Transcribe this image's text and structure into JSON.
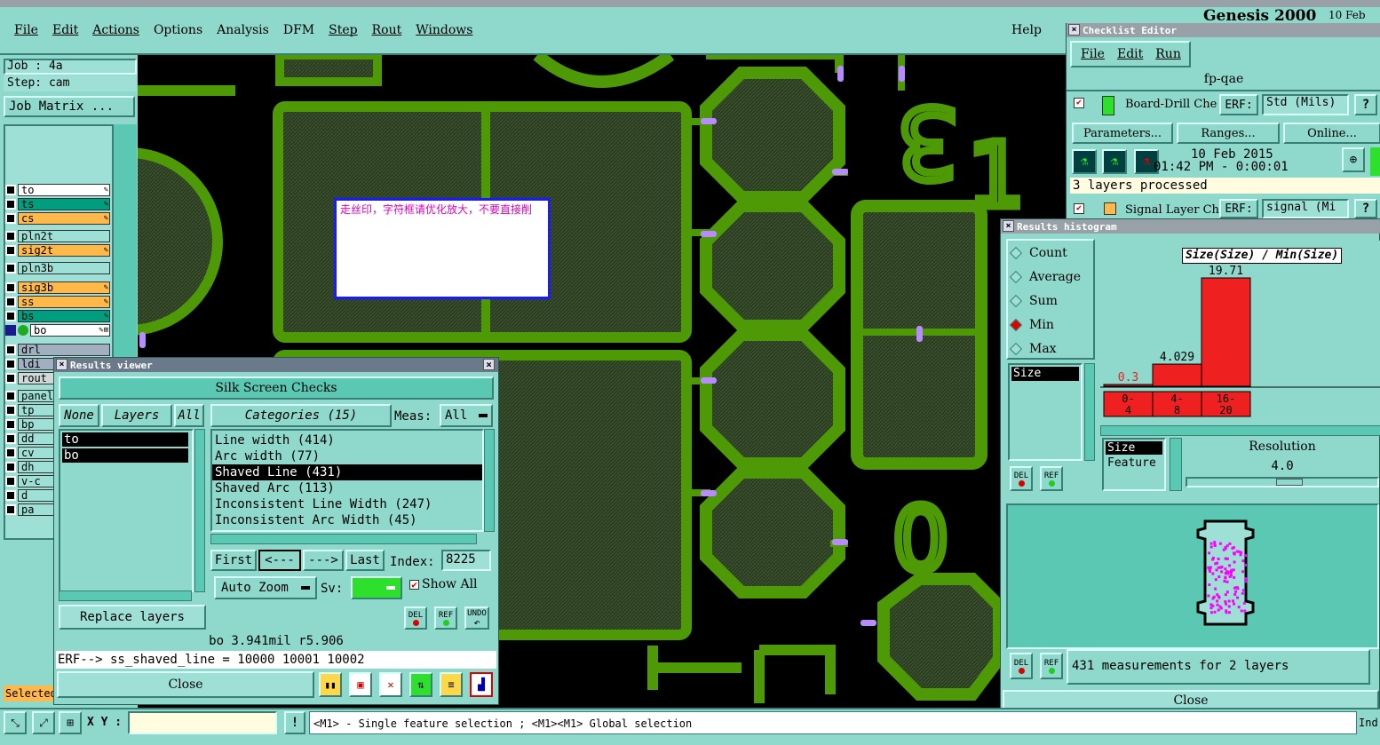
{
  "menu": {
    "items": [
      "File",
      "Edit",
      "Actions",
      "Options",
      "Analysis",
      "DFM",
      "Step",
      "Rout",
      "Windows"
    ],
    "help": "Help"
  },
  "job": {
    "job": "Job : 4a",
    "step": "Step: cam",
    "matrix": "Job Matrix ..."
  },
  "layers": [
    {
      "name": "to",
      "color": "#ffffff",
      "mark": "✎"
    },
    {
      "name": "ts",
      "color": "#009e7e",
      "mark": "✎"
    },
    {
      "name": "cs",
      "color": "#ffb84a",
      "mark": "✎"
    },
    {
      "name": "pln2t",
      "color": "#9ee0d6",
      "mark": ""
    },
    {
      "name": "sig2t",
      "color": "#ffb84a",
      "mark": "✎"
    },
    {
      "name": "pln3b",
      "color": "#9ee0d6",
      "mark": ""
    },
    {
      "name": "sig3b",
      "color": "#ffb84a",
      "mark": "✎"
    },
    {
      "name": "ss",
      "color": "#ffb84a",
      "mark": "✎"
    },
    {
      "name": "bs",
      "color": "#009e7e",
      "mark": "✎"
    },
    {
      "name": "bo",
      "color": "#ffffff",
      "mark": "✎⊞"
    },
    {
      "name": "drl",
      "color": "#a0b0c0",
      "mark": ""
    },
    {
      "name": "ldi",
      "color": "#a0b0c0",
      "mark": ""
    },
    {
      "name": "rout",
      "color": "#d0d8d8",
      "mark": ""
    },
    {
      "name": "panel",
      "color": "#9ee0d6",
      "mark": "✎"
    },
    {
      "name": "tp",
      "color": "#9ee0d6",
      "mark": ""
    },
    {
      "name": "bp",
      "color": "#9ee0d6",
      "mark": ""
    },
    {
      "name": "dd",
      "color": "#9ee0d6",
      "mark": ""
    },
    {
      "name": "cv",
      "color": "#9ee0d6",
      "mark": ""
    },
    {
      "name": "dh",
      "color": "#9ee0d6",
      "mark": ""
    },
    {
      "name": "v-c",
      "color": "#9ee0d6",
      "mark": ""
    },
    {
      "name": "d",
      "color": "#9ee0d6",
      "mark": ""
    },
    {
      "name": "pa",
      "color": "#9ee0d6",
      "mark": ""
    }
  ],
  "selected_label": "Selected",
  "note": {
    "text": "走丝印，字符框请优化放大，不要直接削"
  },
  "board_digits": [
    "3",
    "C1",
    "0"
  ],
  "results_viewer": {
    "title": "Results viewer",
    "header": "Silk Screen Checks",
    "none": "None",
    "layers": "Layers",
    "all": "All",
    "categories": "Categories (15)",
    "meas_label": "Meas:",
    "meas_value": "All",
    "layer_list": [
      "to",
      "bo"
    ],
    "category_list": [
      "Line width (414)",
      "Arc width (77)",
      "Shaved Line (431)",
      "Shaved Arc (113)",
      "Inconsistent Line Width (247)",
      "Inconsistent Arc Width (45)"
    ],
    "first": "First",
    "prev": "<---",
    "next": "--->",
    "last": "Last",
    "index_label": "Index:",
    "index_value": "8225",
    "auto_zoom": "Auto Zoom",
    "sv_label": "Sv:",
    "show_all": "Show All",
    "replace_layers": "Replace layers",
    "del": "DEL",
    "ref": "REF",
    "undo": "UNDO",
    "info": "bo 3.941mil  r5.906",
    "erf": "ERF--> ss_shaved_line = 10000 10001 10002",
    "close": "Close"
  },
  "checklist": {
    "title": "Checklist Editor",
    "menu": [
      "File",
      "Edit",
      "Run"
    ],
    "name": "fp-qae",
    "row1_name": "Board-Drill Che",
    "erf": "ERF:",
    "row1_erf_value": "Std (Mils)",
    "params": "Parameters...",
    "ranges": "Ranges...",
    "online": "Online...",
    "date": "10 Feb 2015",
    "time": "01:42 PM - 0:00:01",
    "processed": "3 layers processed",
    "row2_name": "Signal Layer Ch",
    "row2_erf_value": "signal (Mi",
    "q": "?"
  },
  "genesis_title": "Genesis 2000",
  "genesis_date": "10 Feb",
  "histogram": {
    "title": "Results histogram",
    "options": [
      "Count",
      "Average",
      "Sum",
      "Min",
      "Max"
    ],
    "selected": "Min",
    "chart_title": "Size(Size) / Min(Size)",
    "size_label": "Size",
    "feature_label": "Feature",
    "resolution_label": "Resolution",
    "resolution_value": "4.0",
    "del": "DEL",
    "ref": "REF",
    "measurements": "431 measurements for 2 layers",
    "close": "Close"
  },
  "chart_data": {
    "type": "bar",
    "categories": [
      "0-4",
      "4-8",
      "16-20"
    ],
    "values": [
      0.3,
      4.029,
      19.71
    ],
    "title": "Size(Size) / Min(Size)"
  },
  "status": {
    "xy_label": "X Y :",
    "message": "<M1> - Single feature selection ; <M1><M1> Global selection",
    "right": "Ind"
  }
}
